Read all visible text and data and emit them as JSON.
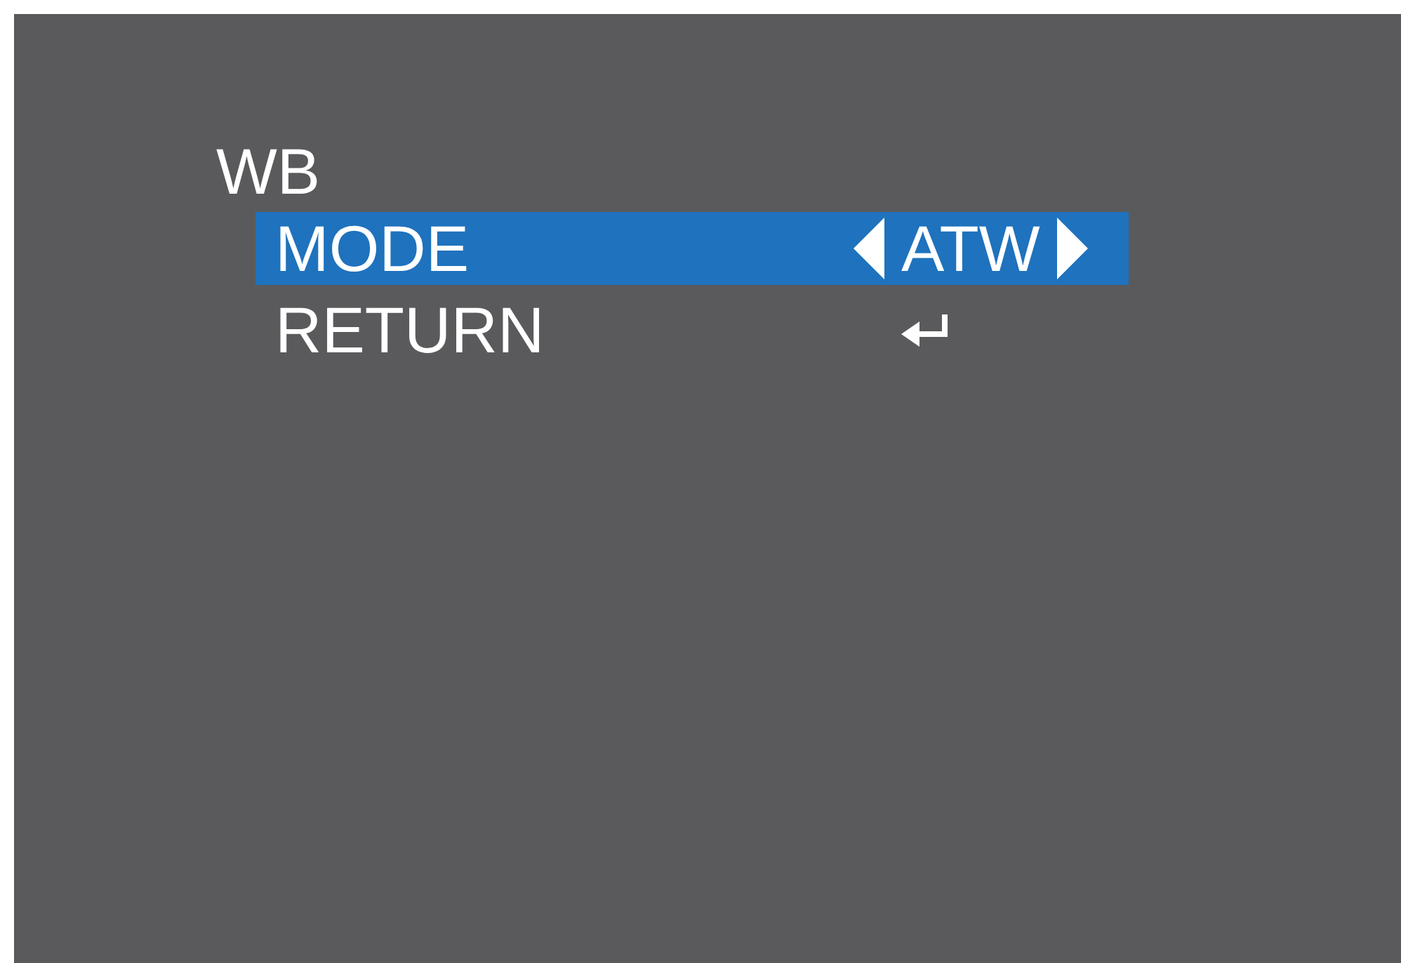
{
  "menu": {
    "title": "WB",
    "items": [
      {
        "kind": "option",
        "label": "MODE",
        "value": "ATW",
        "selected": true
      },
      {
        "kind": "return",
        "label": "RETURN",
        "selected": false
      }
    ]
  }
}
